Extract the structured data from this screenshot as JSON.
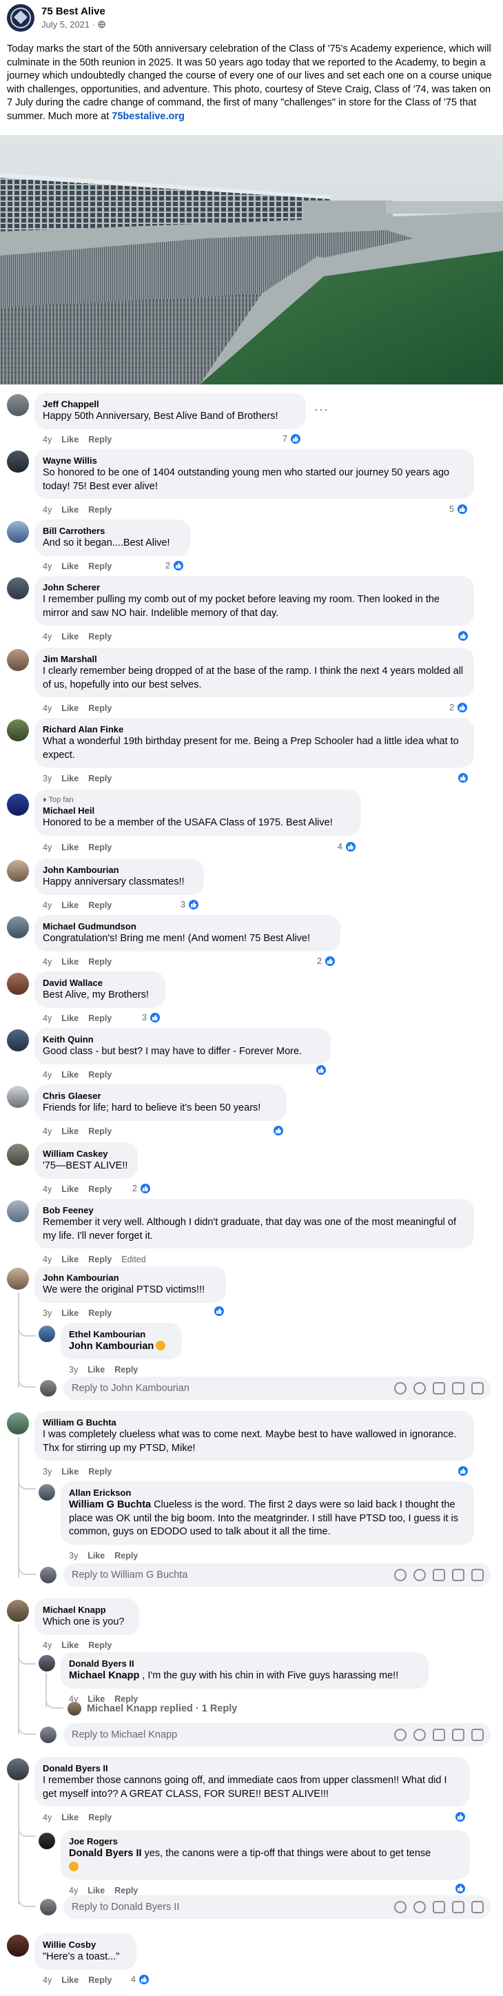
{
  "post": {
    "page_name": "75 Best Alive",
    "date": "July 5, 2021 · ",
    "text_before_link": "Today marks the start of the 50th anniversary celebration of the Class of '75's Academy experience, which will culminate in the 50th reunion in 2025. It was 50 years ago today that we reported to the Academy, to begin a journey which undoubtedly changed the course of every one of our lives and set each one on a course unique with challenges, opportunities, and adventure. This photo, courtesy of Steve Craig, Class of '74, was taken on 7 July during the cadre change of command, the first of many \"challenges\" in store for the Class of '75 that summer. Much more at ",
    "link_text": "75bestalive.org",
    "globe_icon": "globe-icon"
  },
  "labels": {
    "like": "Like",
    "reply": "Reply",
    "edited": "Edited",
    "top_fan": "Top fan",
    "more": "···"
  },
  "colors": {
    "like_blue": "#1877f2",
    "link": "#0b58c4",
    "bubble": "#f0f2f5",
    "meta": "#65676b"
  },
  "comments": {
    "c1": {
      "author": "Jeff Chappell",
      "text": "Happy 50th Anniversary, Best Alive Band of Brothers!",
      "time": "4y",
      "likes": "7"
    },
    "c2": {
      "author": "Wayne Willis",
      "text": "So honored to be one of 1404 outstanding young men who started our journey 50 years ago today! 75! Best ever alive!",
      "time": "4y",
      "likes": "5"
    },
    "c3": {
      "author": "Bill Carrothers",
      "text": "And so it began....Best Alive!",
      "time": "4y",
      "likes": "2"
    },
    "c4": {
      "author": "John Scherer",
      "text": "I remember pulling my comb out of my pocket before leaving my room. Then looked in the mirror and saw NO hair. Indelible memory of that day.",
      "time": "4y",
      "likes": ""
    },
    "c5": {
      "author": "Jim Marshall",
      "text": "I clearly remember being dropped of at the base of the ramp. I think the next 4 years molded all of us, hopefully into our best selves.",
      "time": "4y",
      "likes": "2"
    },
    "c6": {
      "author": "Richard Alan Finke",
      "text": "What a wonderful 19th birthday present for me. Being a Prep Schooler had a little idea what to expect.",
      "time": "3y",
      "likes": ""
    },
    "c7": {
      "author": "Michael Heil",
      "text": "Honored to be a member of the USAFA Class of 1975. Best Alive!",
      "time": "4y",
      "likes": "4"
    },
    "c8": {
      "author": "John Kambourian",
      "text": "Happy anniversary classmates!!",
      "time": "4y",
      "likes": "3"
    },
    "c9": {
      "author": "Michael Gudmundson",
      "text": "Congratulation's! Bring me men! (And women! 75 Best Alive!",
      "time": "4y",
      "likes": "2"
    },
    "c10": {
      "author": "David Wallace",
      "text": "Best Alive, my Brothers!",
      "time": "4y",
      "likes": "3"
    },
    "c11": {
      "author": "Keith Quinn",
      "text": "Good class - but best? I may have to differ - Forever More.",
      "time": "4y",
      "likes": ""
    },
    "c12": {
      "author": "Chris Glaeser",
      "text": "Friends for life; hard to believe it's been 50 years!",
      "time": "4y",
      "likes": ""
    },
    "c13": {
      "author": "William Caskey",
      "text": "'75—BEST ALIVE!!",
      "time": "4y",
      "likes": "2"
    },
    "c14": {
      "author": "Bob Feeney",
      "text": "Remember it very well. Although I didn't graduate, that day was one of the most meaningful of my life. I'll never forget it.",
      "time": "4y",
      "likes": ""
    },
    "c15": {
      "author": "John Kambourian",
      "text": "We were the original PTSD victims!!!",
      "time": "3y",
      "likes": ""
    },
    "c15r1": {
      "author": "Ethel Kambourian",
      "tag": "John Kambourian",
      "text": "",
      "time": "3y"
    },
    "c15box": {
      "placeholder": "Reply to John Kambourian"
    },
    "c16": {
      "author": "William G Buchta",
      "text": "I was completely clueless what was to come next. Maybe best to have wallowed in ignorance. Thx for stirring up my PTSD, Mike!",
      "time": "3y",
      "likes": ""
    },
    "c16r1": {
      "author": "Allan Erickson",
      "tag": "William G Buchta",
      "text": " Clueless is the word. The first 2 days were so laid back I thought the place was OK until the big boom. Into the meatgrinder. I still have PTSD too, I guess it is common, guys on EDODO used to talk about it all the time.",
      "time": "3y"
    },
    "c16box": {
      "placeholder": "Reply to William G Buchta"
    },
    "c17": {
      "author": "Michael Knapp",
      "text": "Which one is you?",
      "time": "4y",
      "likes": ""
    },
    "c17r1": {
      "author": "Donald Byers II",
      "tag": "Michael Knapp",
      "text": " , I'm the guy with his chin in with Five guys harassing me!!",
      "time": "4y"
    },
    "c17replied": "Michael Knapp replied · 1 Reply",
    "c17box": {
      "placeholder": "Reply to Michael Knapp"
    },
    "c18": {
      "author": "Donald Byers II",
      "text": "I remember those cannons going off, and immediate caos from upper classmen!! What did I get myself into?? A GREAT CLASS, FOR SURE!! BEST ALIVE!!!",
      "time": "4y",
      "likes": ""
    },
    "c18r1": {
      "author": "Joe Rogers",
      "tag": "Donald Byers II",
      "text": " yes, the canons were a tip-off that things were about to get tense",
      "time": "4y"
    },
    "c18box": {
      "placeholder": "Reply to Donald Byers II"
    },
    "c19": {
      "author": "Willie Cosby",
      "text": "\"Here's a toast...\"",
      "time": "4y",
      "likes": "4"
    }
  }
}
